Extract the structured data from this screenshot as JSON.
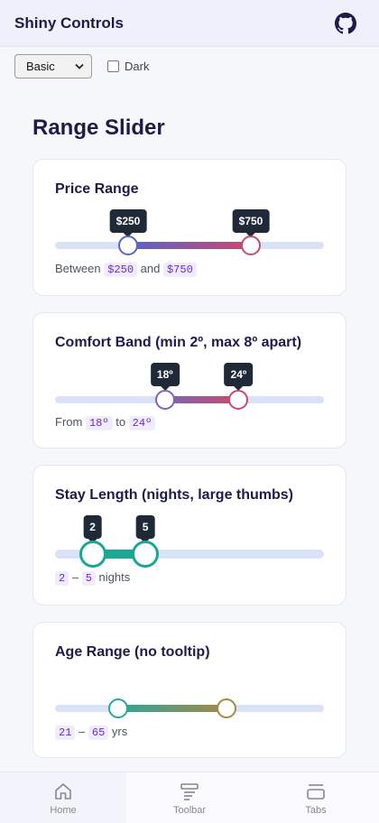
{
  "app": {
    "title": "Shiny Controls",
    "github_icon": "github-icon"
  },
  "controls": {
    "theme_select": {
      "value": "Basic",
      "options": [
        "Basic"
      ]
    },
    "dark_toggle": {
      "label": "Dark",
      "checked": false
    }
  },
  "page_title": "Range Slider",
  "sliders": [
    {
      "title": "Price Range",
      "min": 0,
      "max": 1000,
      "low": 250,
      "high": 750,
      "low_tip": "$250",
      "high_tip": "$750",
      "readout_prefix": "Between",
      "readout_low": "$250",
      "readout_mid": "and",
      "readout_high": "$750",
      "readout_suffix": "",
      "colors": {
        "low": "#5b63c9",
        "high": "#c84a6e"
      }
    },
    {
      "title": "Comfort Band (min 2º, max 8º apart)",
      "min": 10,
      "max": 30,
      "low": 18,
      "high": 24,
      "low_tip": "18º",
      "high_tip": "24º",
      "readout_prefix": "From",
      "readout_low": "18º",
      "readout_mid": "to",
      "readout_high": "24º",
      "readout_suffix": "",
      "colors": {
        "low": "#7d65b8",
        "high": "#c84a6e"
      }
    },
    {
      "title": "Stay Length (nights, large thumbs)",
      "min": 1,
      "max": 14,
      "low": 2,
      "high": 5,
      "low_tip": "2",
      "high_tip": "5",
      "readout_prefix": "",
      "readout_low": "2",
      "readout_mid": "–",
      "readout_high": "5",
      "readout_suffix": "nights",
      "colors": {
        "low": "#1aa894",
        "high": "#1aa894"
      }
    },
    {
      "title": "Age Range (no tooltip)",
      "min": 0,
      "max": 100,
      "low": 21,
      "high": 65,
      "readout_prefix": "",
      "readout_low": "21",
      "readout_mid": "–",
      "readout_high": "65",
      "readout_suffix": "yrs",
      "colors": {
        "low": "#2aa79a",
        "high": "#a48a45"
      }
    }
  ],
  "nav": [
    {
      "label": "Home",
      "icon": "home-icon",
      "active": true
    },
    {
      "label": "Toolbar",
      "icon": "toolbar-icon",
      "active": false
    },
    {
      "label": "Tabs",
      "icon": "tabs-icon",
      "active": false
    }
  ]
}
